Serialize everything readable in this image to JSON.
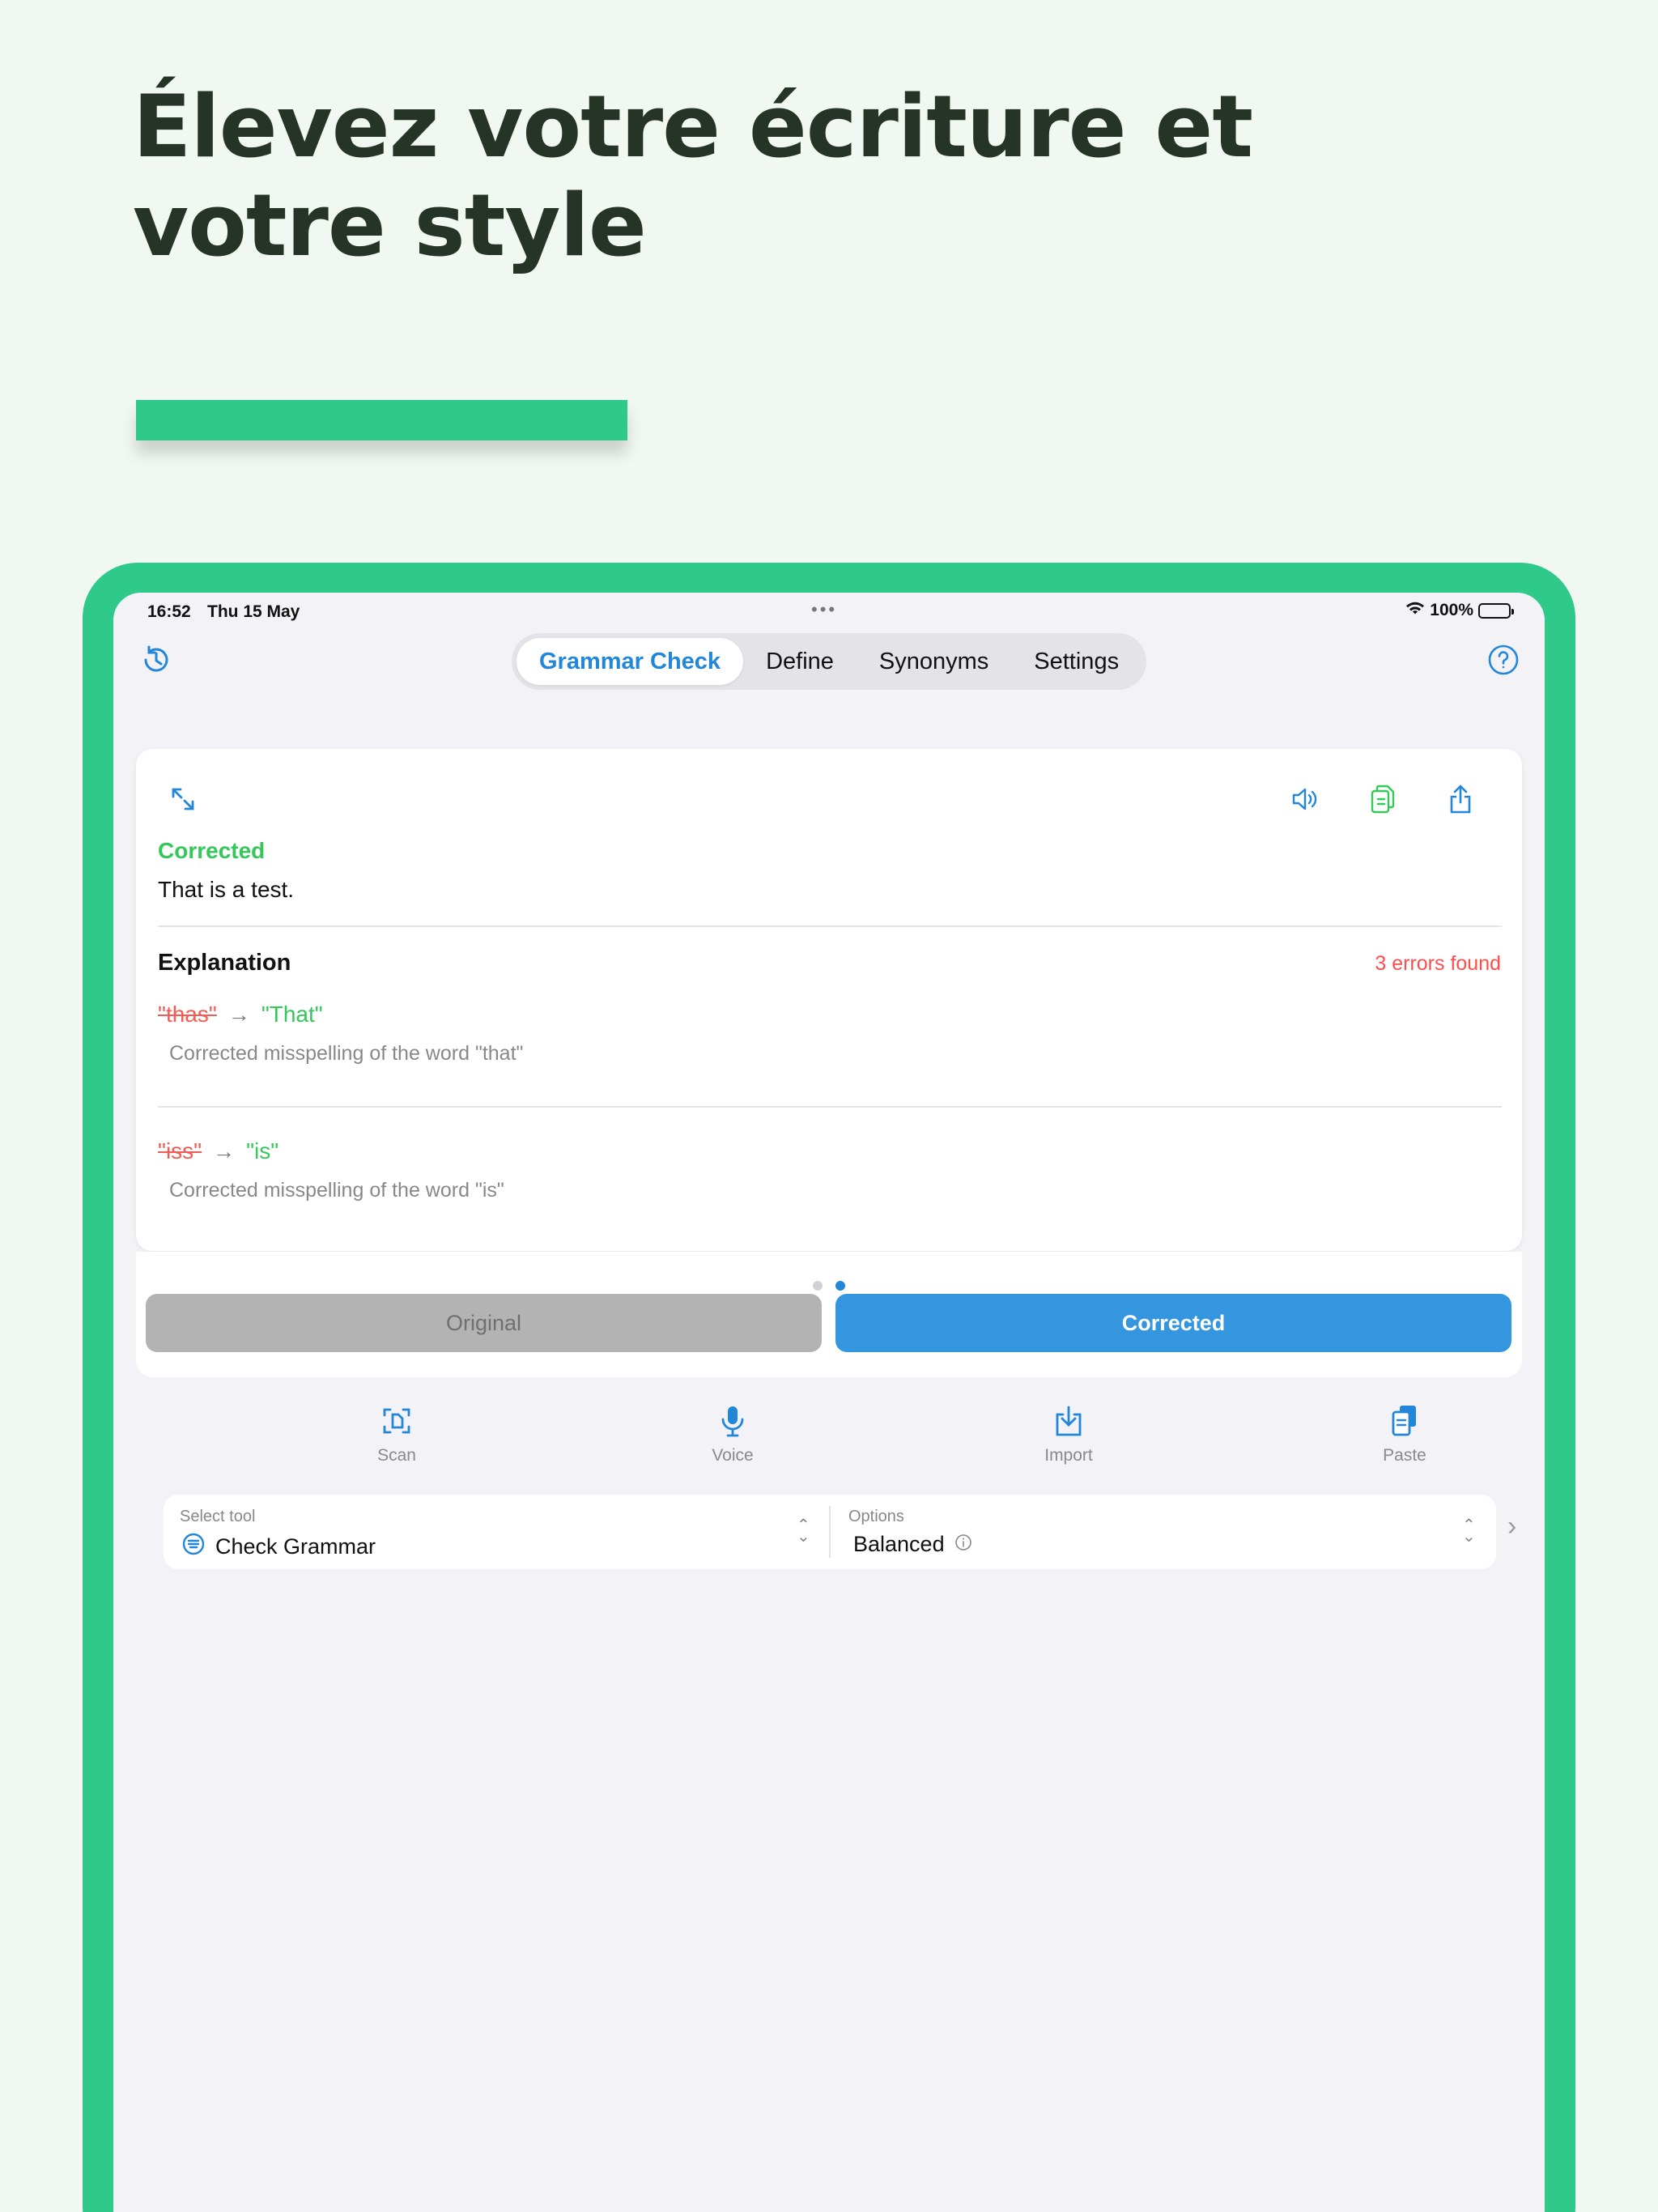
{
  "headline": "Élevez votre écriture et votre style",
  "status_bar": {
    "time": "16:52",
    "date": "Thu 15 May",
    "battery_percent": "100%"
  },
  "tabs": [
    {
      "label": "Grammar Check",
      "active": true
    },
    {
      "label": "Define",
      "active": false
    },
    {
      "label": "Synonyms",
      "active": false
    },
    {
      "label": "Settings",
      "active": false
    }
  ],
  "result": {
    "corrected_heading": "Corrected",
    "corrected_text": "That is a test.",
    "explanation_heading": "Explanation",
    "errors_found": "3 errors found",
    "changes": [
      {
        "old": "\"thas\"",
        "new": "\"That\"",
        "note": "Corrected misspelling of the word \"that\""
      },
      {
        "old": "\"iss\"",
        "new": "\"is\"",
        "note": "Corrected misspelling of the word \"is\""
      }
    ]
  },
  "toggle": {
    "original_label": "Original",
    "corrected_label": "Corrected",
    "active": "corrected"
  },
  "actions": [
    {
      "label": "Scan",
      "icon": "scan-icon"
    },
    {
      "label": "Voice",
      "icon": "microphone-icon"
    },
    {
      "label": "Import",
      "icon": "import-icon"
    },
    {
      "label": "Paste",
      "icon": "paste-icon"
    }
  ],
  "selector": {
    "tool_label": "Select tool",
    "tool_value": "Check Grammar",
    "options_label": "Options",
    "options_value": "Balanced"
  },
  "colors": {
    "accent_green": "#2ec98b",
    "link_blue": "#2286d9",
    "success_green": "#34c759",
    "error_red": "#ff4d4d"
  }
}
